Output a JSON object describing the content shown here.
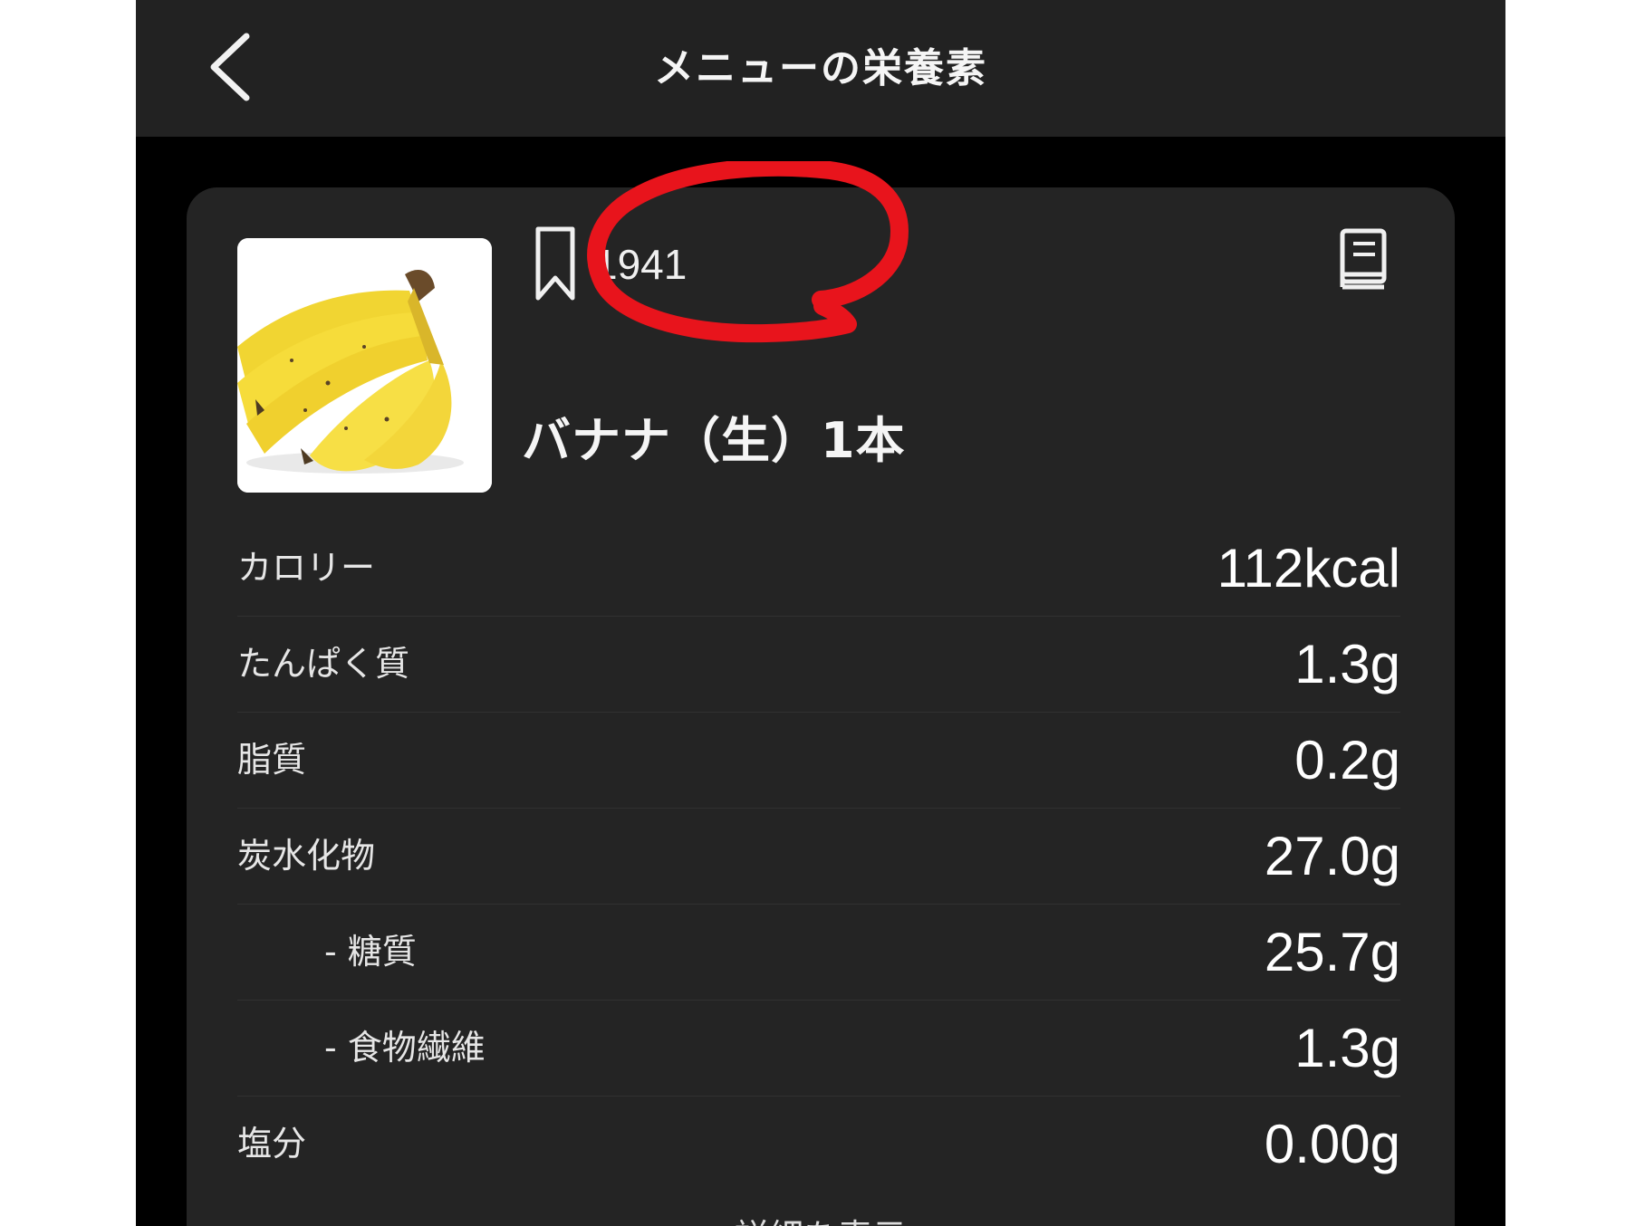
{
  "header": {
    "title": "メニューの栄養素",
    "back_icon": "chevron-left-icon"
  },
  "food": {
    "name": "バナナ（生）1本",
    "bookmark_count": "1941",
    "bookmark_icon": "bookmark-icon",
    "book_icon": "book-icon"
  },
  "nutrients": [
    {
      "label": "カロリー",
      "value": "112kcal"
    },
    {
      "label": "たんぱく質",
      "value": "1.3g"
    },
    {
      "label": "脂質",
      "value": "0.2g"
    },
    {
      "label": "炭水化物",
      "value": "27.0g"
    },
    {
      "label": "- 糖質",
      "value": "25.7g"
    },
    {
      "label": "- 食物繊維",
      "value": "1.3g"
    },
    {
      "label": "塩分",
      "value": "0.00g"
    }
  ],
  "footer": {
    "details_label": "詳細を表示"
  },
  "colors": {
    "background": "#000000",
    "navbar": "#222222",
    "card": "#242424",
    "annotation": "#e8141c"
  }
}
